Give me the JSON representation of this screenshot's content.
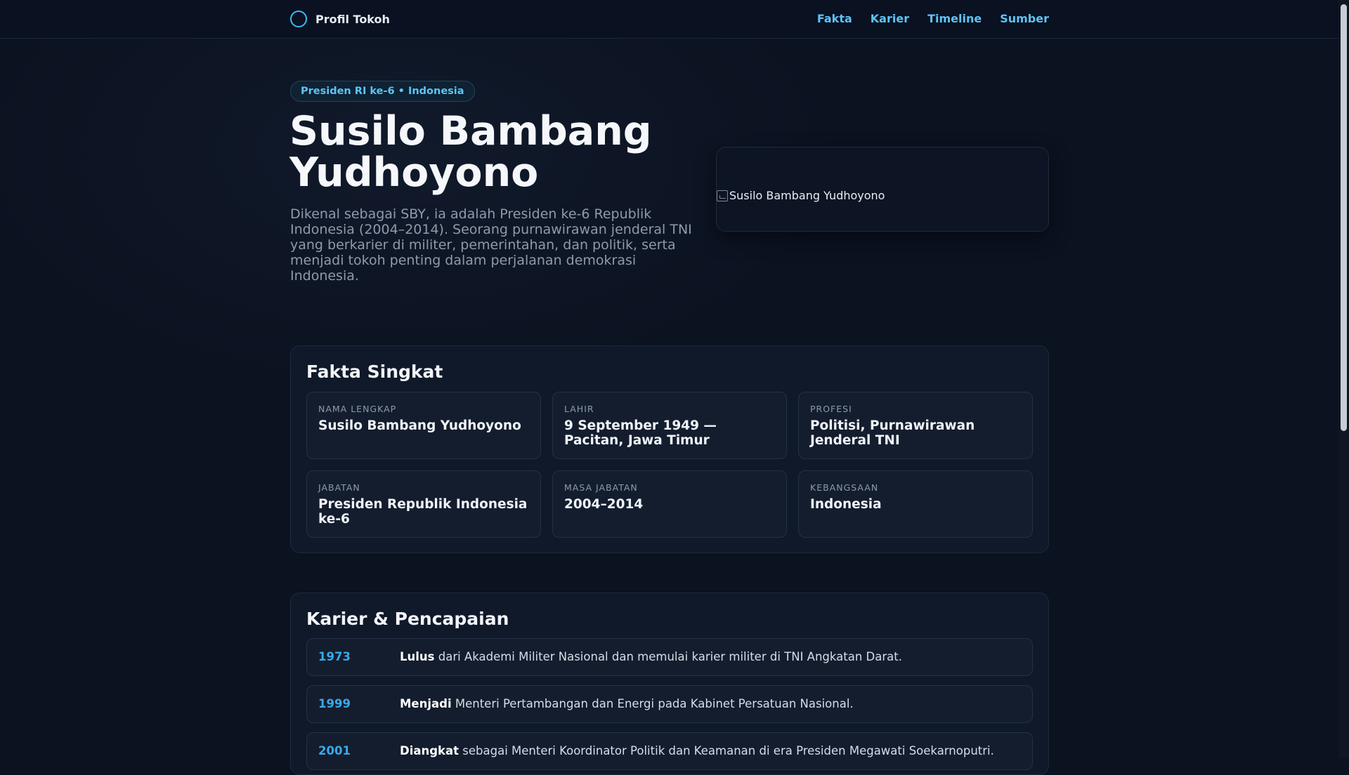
{
  "header": {
    "brand": "Profil Tokoh",
    "nav": [
      "Fakta",
      "Karier",
      "Timeline",
      "Sumber"
    ]
  },
  "hero": {
    "badge": "Presiden RI ke-6 • Indonesia",
    "title": "Susilo Bambang Yudhoyono",
    "description": "Dikenal sebagai SBY, ia adalah Presiden ke-6 Republik Indonesia (2004–2014). Seorang purnawirawan jenderal TNI yang berkarier di militer, pemerintahan, dan politik, serta menjadi tokoh penting dalam perjalanan demokrasi Indonesia.",
    "photo_alt": "Susilo Bambang Yudhoyono"
  },
  "facts": {
    "title": "Fakta Singkat",
    "items": [
      {
        "label": "NAMA LENGKAP",
        "value": "Susilo Bambang Yudhoyono"
      },
      {
        "label": "LAHIR",
        "value": "9 September 1949 — Pacitan, Jawa Timur"
      },
      {
        "label": "PROFESI",
        "value": "Politisi, Purnawirawan Jenderal TNI"
      },
      {
        "label": "JABATAN",
        "value": "Presiden Republik Indonesia ke-6"
      },
      {
        "label": "MASA JABATAN",
        "value": "2004–2014"
      },
      {
        "label": "KEBANGSAAN",
        "value": "Indonesia"
      }
    ]
  },
  "career": {
    "title": "Karier & Pencapaian",
    "items": [
      {
        "year": "1973",
        "lead": "Lulus",
        "text": " dari Akademi Militer Nasional dan memulai karier militer di TNI Angkatan Darat."
      },
      {
        "year": "1999",
        "lead": "Menjadi",
        "text": " Menteri Pertambangan dan Energi pada Kabinet Persatuan Nasional."
      },
      {
        "year": "2001",
        "lead": "Diangkat",
        "text": " sebagai Menteri Koordinator Politik dan Keamanan di era Presiden Megawati Soekarnoputri."
      }
    ]
  },
  "colors": {
    "accent": "#5ec3f5",
    "background": "#0b1220"
  }
}
